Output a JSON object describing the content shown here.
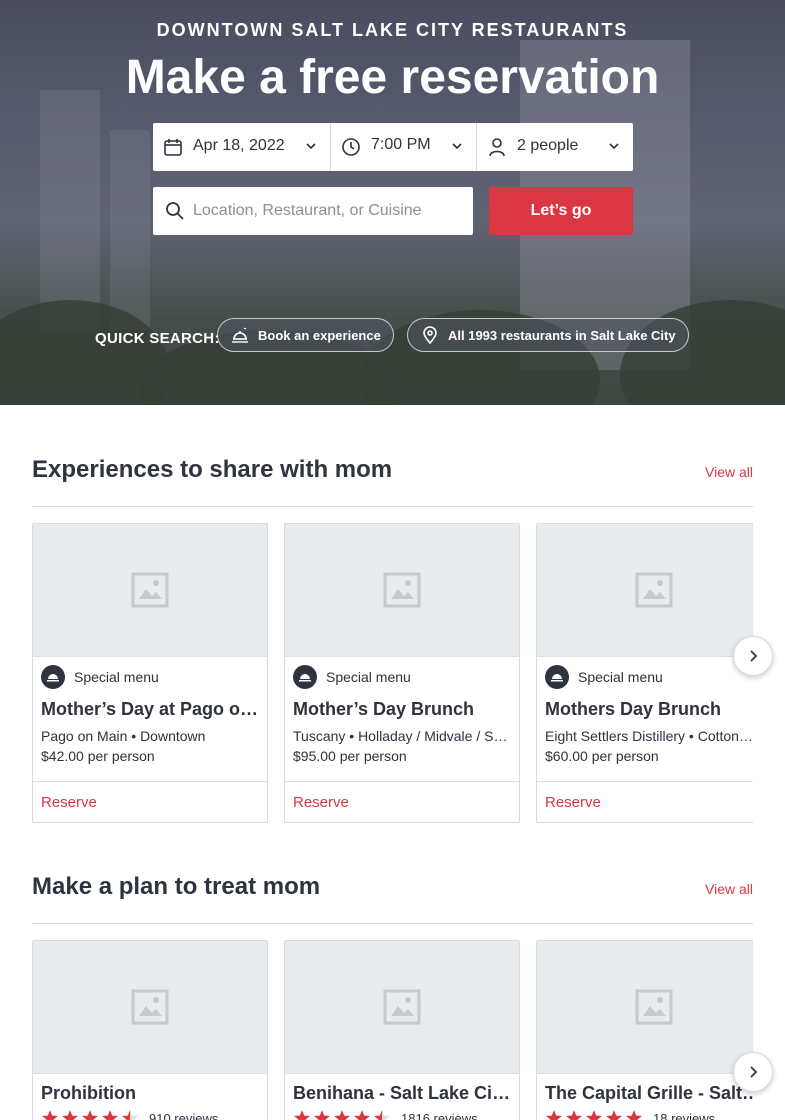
{
  "hero": {
    "kicker": "DOWNTOWN SALT LAKE CITY RESTAURANTS",
    "title": "Make a free reservation",
    "date": "Apr 18, 2022",
    "time": "7:00 PM",
    "party": "2 people",
    "search_placeholder": "Location, Restaurant, or Cuisine",
    "go_label": "Let’s go",
    "quick_search_label": "QUICK SEARCH:",
    "quick_links": [
      "Book an experience",
      "All 1993 restaurants in Salt Lake City"
    ]
  },
  "colors": {
    "brand": "#da3743",
    "text": "#2d333f",
    "border": "#d8d9db"
  },
  "section1": {
    "title": "Experiences to share with mom",
    "view_all": "View all",
    "cards": [
      {
        "badge": "Special menu",
        "name": "Mother’s Day at Pago on Main",
        "meta": "Pago on Main • Downtown",
        "price": "$42.00 per person",
        "action": "Reserve"
      },
      {
        "badge": "Special menu",
        "name": "Mother’s Day Brunch",
        "meta": "Tuscany • Holladay / Midvale / Sandy",
        "price": "$95.00 per person",
        "action": "Reserve"
      },
      {
        "badge": "Special menu",
        "name": "Mothers Day Brunch",
        "meta": "Eight Settlers Distillery • Cottonwood",
        "price": "$60.00 per person",
        "action": "Reserve"
      }
    ]
  },
  "section2": {
    "title": "Make a plan to treat mom",
    "view_all": "View all",
    "cards": [
      {
        "name": "Prohibition",
        "rating": 4.5,
        "reviews": "910 reviews"
      },
      {
        "name": "Benihana - Salt Lake City, UT",
        "rating": 4.5,
        "reviews": "1816 reviews"
      },
      {
        "name": "The Capital Grille - Salt Lake City",
        "rating": 5,
        "reviews": "18 reviews"
      }
    ]
  }
}
